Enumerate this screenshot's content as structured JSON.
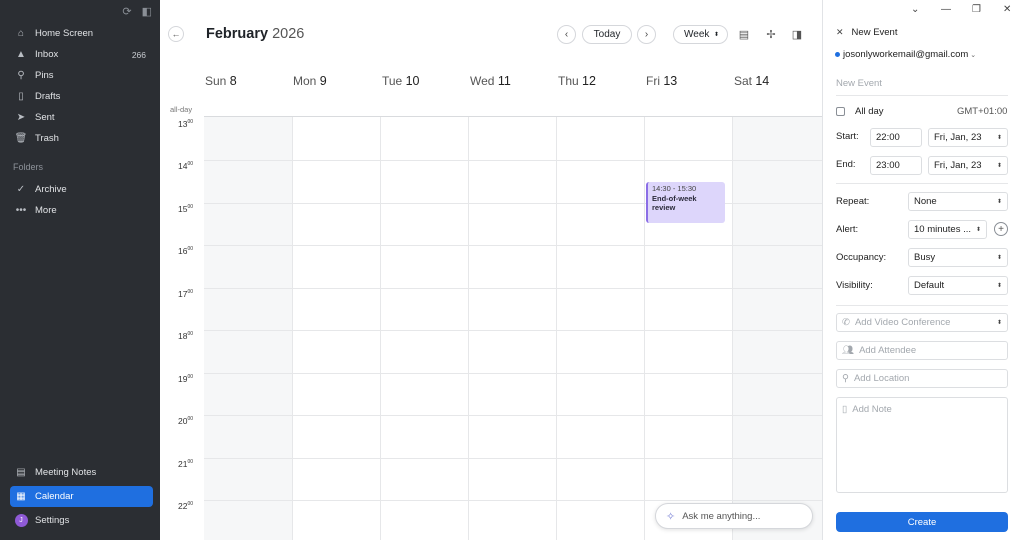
{
  "sidebar": {
    "items": [
      {
        "label": "Home Screen",
        "icon": "home-icon"
      },
      {
        "label": "Inbox",
        "icon": "inbox-icon",
        "count": "266"
      },
      {
        "label": "Pins",
        "icon": "pin-icon"
      },
      {
        "label": "Drafts",
        "icon": "draft-icon"
      },
      {
        "label": "Sent",
        "icon": "sent-icon"
      },
      {
        "label": "Trash",
        "icon": "trash-icon"
      }
    ],
    "folders_label": "Folders",
    "folders": [
      {
        "label": "Archive",
        "icon": "check-icon"
      },
      {
        "label": "More",
        "icon": "more-icon"
      }
    ],
    "bottom": [
      {
        "label": "Meeting Notes",
        "icon": "notes-icon"
      },
      {
        "label": "Calendar",
        "icon": "calendar-icon",
        "active": true
      },
      {
        "label": "Settings",
        "icon": "avatar",
        "avatar_letter": "J"
      }
    ]
  },
  "calendar": {
    "month": "February",
    "year": "2026",
    "today_label": "Today",
    "view_label": "Week",
    "allday_label": "all-day",
    "days": [
      {
        "name": "Sun",
        "num": "8"
      },
      {
        "name": "Mon",
        "num": "9"
      },
      {
        "name": "Tue",
        "num": "10"
      },
      {
        "name": "Wed",
        "num": "11"
      },
      {
        "name": "Thu",
        "num": "12"
      },
      {
        "name": "Fri",
        "num": "13"
      },
      {
        "name": "Sat",
        "num": "14"
      }
    ],
    "hours": [
      "13",
      "14",
      "15",
      "16",
      "17",
      "18",
      "19",
      "20",
      "21",
      "22"
    ],
    "hour_suffix": "00",
    "event": {
      "time": "14:30 - 15:30",
      "title": "End-of-week review"
    },
    "ask_placeholder": "Ask me anything..."
  },
  "panel": {
    "title": "New Event",
    "account": "josonlyworkemail@gmail.com",
    "event_name_placeholder": "New Event",
    "allday_label": "All day",
    "timezone": "GMT+01:00",
    "start_label": "Start:",
    "start_time": "22:00",
    "start_date": "Fri, Jan, 23",
    "end_label": "End:",
    "end_time": "23:00",
    "end_date": "Fri, Jan, 23",
    "repeat_label": "Repeat:",
    "repeat_value": "None",
    "alert_label": "Alert:",
    "alert_value": "10 minutes ...",
    "occupancy_label": "Occupancy:",
    "occupancy_value": "Busy",
    "visibility_label": "Visibility:",
    "visibility_value": "Default",
    "video_placeholder": "Add Video Conference",
    "attendee_placeholder": "Add Attendee",
    "location_placeholder": "Add Location",
    "note_placeholder": "Add Note",
    "create_label": "Create"
  },
  "colors": {
    "sidebar_bg": "#2b2e33",
    "accent": "#1f6fe0",
    "event_bg": "#ddd6fb",
    "event_border": "#8b6ee6"
  }
}
